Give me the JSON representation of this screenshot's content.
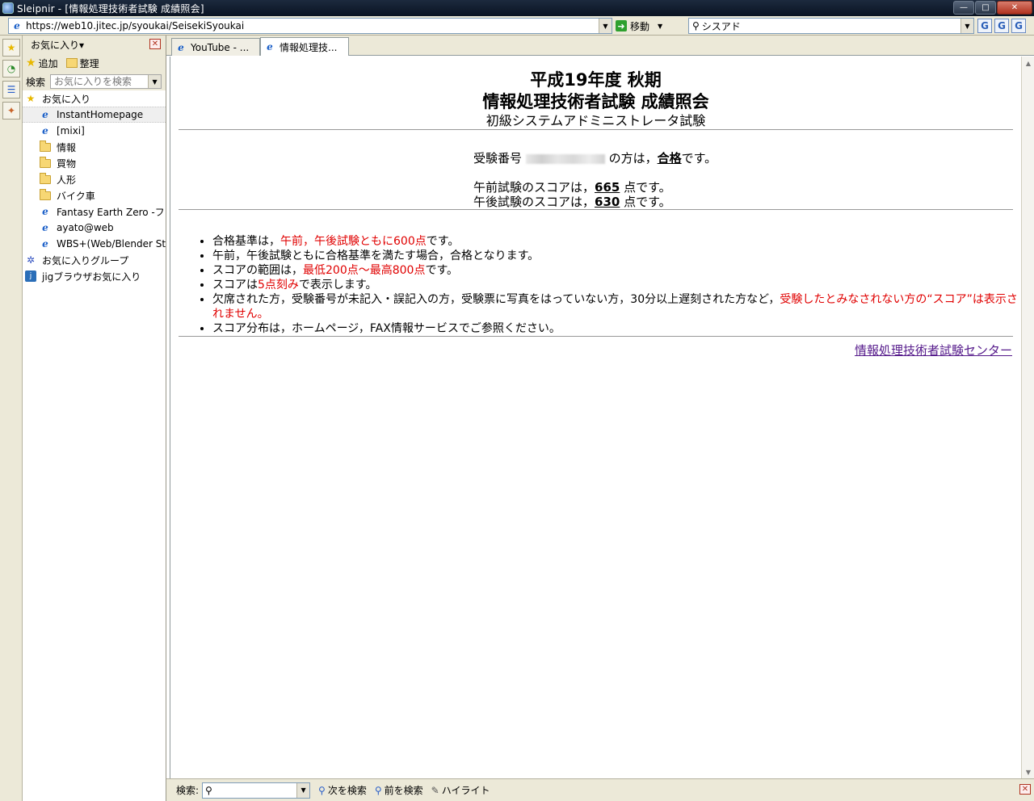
{
  "window": {
    "title": "Sleipnir - [情報処理技術者試験 成績照会]",
    "controls": {
      "minimize": "—",
      "maximize": "□",
      "close": "✕"
    }
  },
  "address_bar": {
    "url": "https://web10.jitec.jp/syoukai/SeisekiSyoukai",
    "go_label": "移動",
    "search_value": "シスアド",
    "search_engines": [
      "G",
      "G",
      "G"
    ]
  },
  "favorites": {
    "header": "お気に入り▾",
    "add_label": "追加",
    "organize_label": "整理",
    "search_label": "検索",
    "search_placeholder": "お気に入りを検索",
    "items": [
      {
        "label": "お気に入り",
        "icon": "star"
      },
      {
        "label": "InstantHomepage",
        "icon": "ie-page"
      },
      {
        "label": "[mixi]",
        "icon": "ie-page"
      },
      {
        "label": "情報",
        "icon": "folder"
      },
      {
        "label": "買物",
        "icon": "folder"
      },
      {
        "label": "人形",
        "icon": "folder"
      },
      {
        "label": "バイク車",
        "icon": "folder"
      },
      {
        "label": "Fantasy Earth Zero -フ",
        "icon": "ie-page"
      },
      {
        "label": "ayato@web",
        "icon": "ie-page"
      },
      {
        "label": "WBS+(Web/Blender St",
        "icon": "ie-page"
      },
      {
        "label": "お気に入りグループ",
        "icon": "group"
      },
      {
        "label": "jigブラウザお気に入り",
        "icon": "jig"
      }
    ]
  },
  "tabs": [
    {
      "label": "YouTube - ..."
    },
    {
      "label": "情報処理技..."
    }
  ],
  "page": {
    "title_line1": "平成19年度 秋期",
    "title_line2": "情報処理技術者試験 成績照会",
    "subtitle": "初級システムアドミニストレータ試験",
    "result": {
      "prefix": "受験番号",
      "suffix": "の方は，",
      "status": "合格",
      "end": "です。"
    },
    "scores": {
      "am_prefix": "午前試験のスコアは，",
      "am_score": "665",
      "pm_prefix": "午後試験のスコアは，",
      "pm_score": "630",
      "suffix": "点です。"
    },
    "notes": {
      "n1_a": "合格基準は，",
      "n1_red": "午前，午後試験ともに600点",
      "n1_b": "です。",
      "n2": "午前，午後試験ともに合格基準を満たす場合，合格となります。",
      "n3_a": "スコアの範囲は，",
      "n3_red": "最低200点～最高800点",
      "n3_b": "です。",
      "n4_a": "スコアは",
      "n4_red": "5点刻み",
      "n4_b": "で表示します。",
      "n5_a": "欠席された方，受験番号が未記入・誤記入の方，受験票に写真をはっていない方，30分以上遅刻された方など，",
      "n5_red": "受験したとみなされない方の“スコア”は表示されません。",
      "n6": "スコア分布は，ホームページ，FAX情報サービスでご参照ください。"
    },
    "footer_link": "情報処理技術者試験センター"
  },
  "find_bar": {
    "label": "検索:",
    "next_label": "次を検索",
    "prev_label": "前を検索",
    "highlight_label": "ハイライト"
  }
}
